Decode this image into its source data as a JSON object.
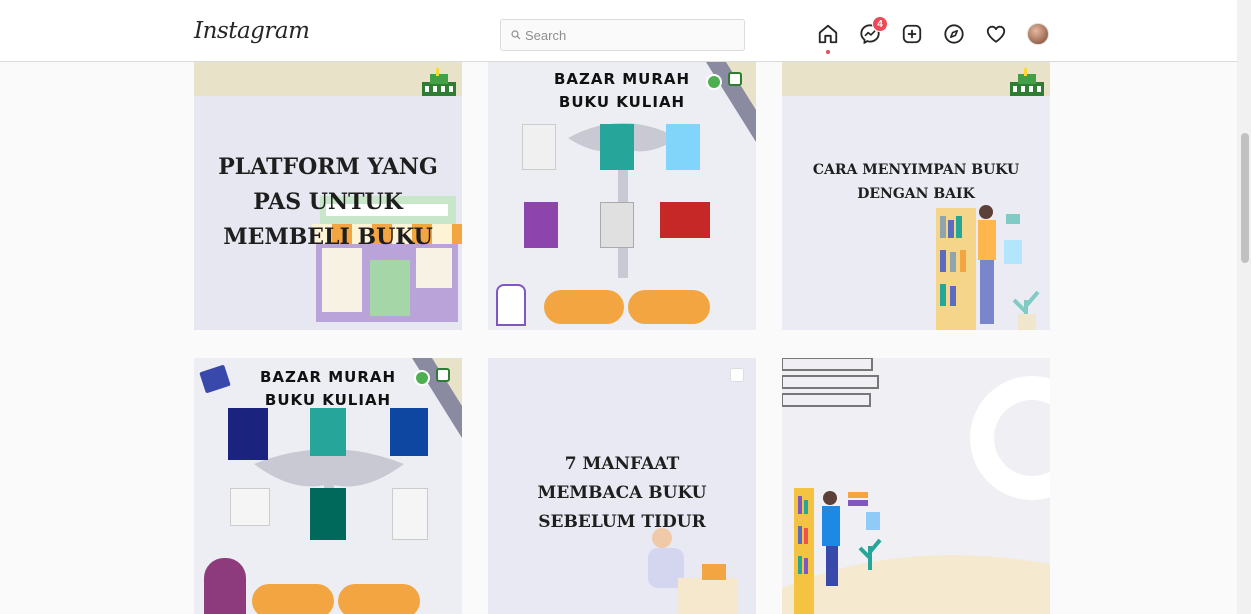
{
  "header": {
    "logo": "Instagram",
    "search_placeholder": "Search",
    "messages_badge": "4"
  },
  "icons": [
    "home-icon",
    "messenger-icon",
    "new-post-icon",
    "explore-icon",
    "activity-icon",
    "profile-avatar"
  ],
  "posts": [
    {
      "lines": [
        "PLATFORM YANG",
        "PAS UNTUK",
        "MEMBELI BUKU"
      ]
    },
    {
      "title_lines": [
        "BAZAR MURAH",
        "BUKU KULIAH"
      ]
    },
    {
      "lines": [
        "CARA MENYIMPAN BUKU",
        "DENGAN BAIK"
      ]
    },
    {
      "title_lines": [
        "BAZAR MURAH",
        "BUKU KULIAH"
      ]
    },
    {
      "lines": [
        "7 MANFAAT",
        "MEMBACA BUKU",
        "SEBELUM TIDUR"
      ]
    },
    {
      "lines": []
    }
  ],
  "colors": {
    "accent": "#ed4956",
    "border": "#dbdbdb",
    "background": "#fafafa",
    "orange": "#f2a541"
  }
}
